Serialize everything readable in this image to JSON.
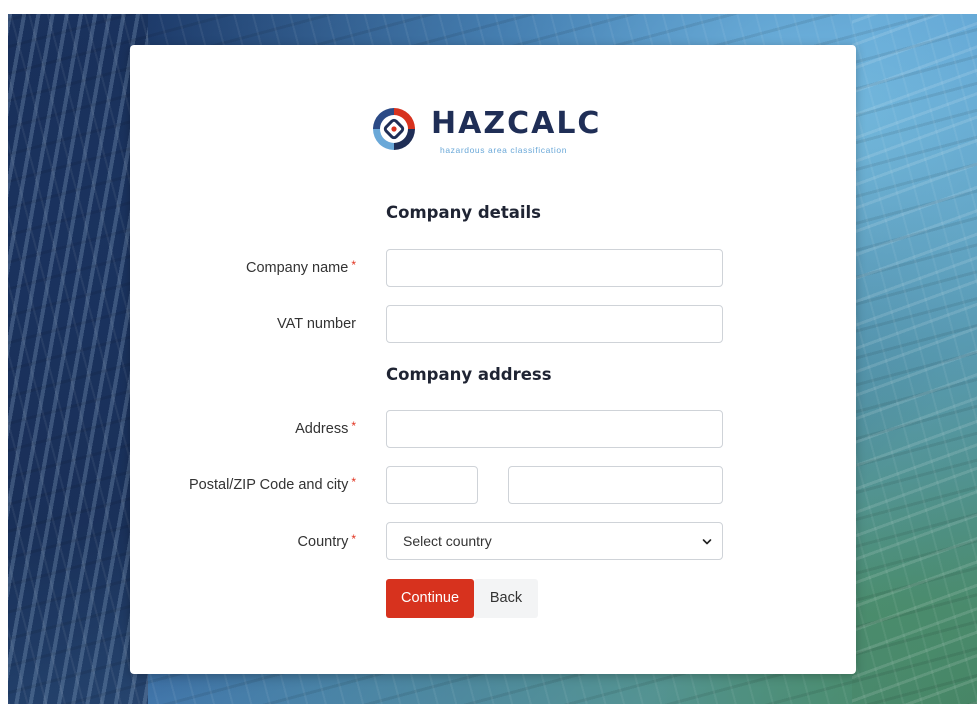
{
  "brand": {
    "name": "HAZCALC",
    "tagline": "hazardous area classification",
    "colors": {
      "navy": "#1f2e56",
      "accent_red": "#d7321e",
      "accent_blue": "#6aa8d8"
    }
  },
  "sections": {
    "details_title": "Company details",
    "address_title": "Company address"
  },
  "fields": {
    "company_name": {
      "label": "Company name",
      "required": "*",
      "value": "",
      "placeholder": ""
    },
    "vat_number": {
      "label": "VAT number",
      "value": "",
      "placeholder": ""
    },
    "address": {
      "label": "Address",
      "required": "*",
      "value": "",
      "placeholder": ""
    },
    "postal_city": {
      "label": "Postal/ZIP Code and city",
      "required": "*",
      "postal_value": "",
      "city_value": ""
    },
    "country": {
      "label": "Country",
      "required": "*",
      "selected": "Select country"
    }
  },
  "actions": {
    "continue_label": "Continue",
    "back_label": "Back"
  },
  "icons": {
    "logo": "hazcalc-logo-icon",
    "dropdown": "chevron-down-icon"
  }
}
